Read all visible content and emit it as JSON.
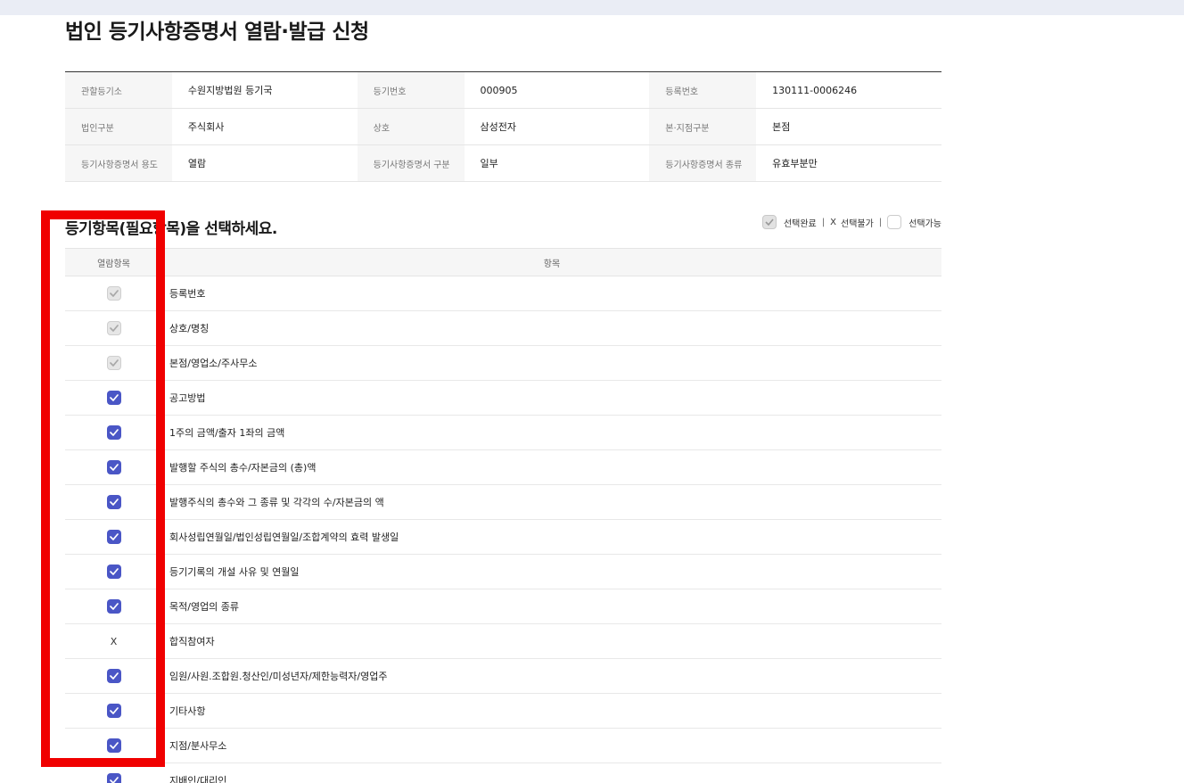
{
  "page": {
    "title": "법인 등기사항증명서 열람·발급 신청"
  },
  "info": [
    [
      {
        "label": "관할등기소",
        "value": "수원지방법원 등기국"
      },
      {
        "label": "등기번호",
        "value": "000905"
      },
      {
        "label": "등록번호",
        "value": "130111-0006246"
      }
    ],
    [
      {
        "label": "법인구분",
        "value": "주식회사"
      },
      {
        "label": "상호",
        "value": "삼성전자"
      },
      {
        "label": "본·지점구분",
        "value": "본점"
      }
    ],
    [
      {
        "label": "등기사항증명서 용도",
        "value": "열람"
      },
      {
        "label": "등기사항증명서 구분",
        "value": "일부"
      },
      {
        "label": "등기사항증명서 종류",
        "value": "유효부분만"
      }
    ]
  ],
  "section": {
    "title": "등기항목(필요항목)을 선택하세요."
  },
  "legend": {
    "done": "선택완료",
    "x": "X",
    "unavailable": "선택불가",
    "sep": "|",
    "available": "선택가능"
  },
  "table": {
    "headers": {
      "check": "열람항목",
      "item": "항목"
    },
    "rows": [
      {
        "state": "disabled",
        "label": "등록번호"
      },
      {
        "state": "disabled",
        "label": "상호/명칭"
      },
      {
        "state": "disabled",
        "label": "본점/영업소/주사무소"
      },
      {
        "state": "checked",
        "label": "공고방법"
      },
      {
        "state": "checked",
        "label": "1주의 금액/출자 1좌의 금액"
      },
      {
        "state": "checked",
        "label": "발행할 주식의 총수/자본금의 (총)액"
      },
      {
        "state": "checked",
        "label": "발행주식의 총수와 그 종류 및 각각의 수/자본금의 액"
      },
      {
        "state": "checked",
        "label": "회사성립연월일/법인성립연월일/조합계약의 효력 발생일"
      },
      {
        "state": "checked",
        "label": "등기기록의 개설 사유 및 연월일"
      },
      {
        "state": "checked",
        "label": "목적/영업의 종류"
      },
      {
        "state": "x",
        "label": "합직참여자",
        "mark": "X"
      },
      {
        "state": "checked",
        "label": "임원/사원.조합원.청산인/미성년자/제한능력자/영업주"
      },
      {
        "state": "checked",
        "label": "기타사항"
      },
      {
        "state": "checked",
        "label": "지점/분사무소"
      },
      {
        "state": "checked",
        "label": "지배인/대리인"
      }
    ]
  },
  "colors": {
    "accent": "#4a56c6",
    "highlight": "#f00000"
  }
}
